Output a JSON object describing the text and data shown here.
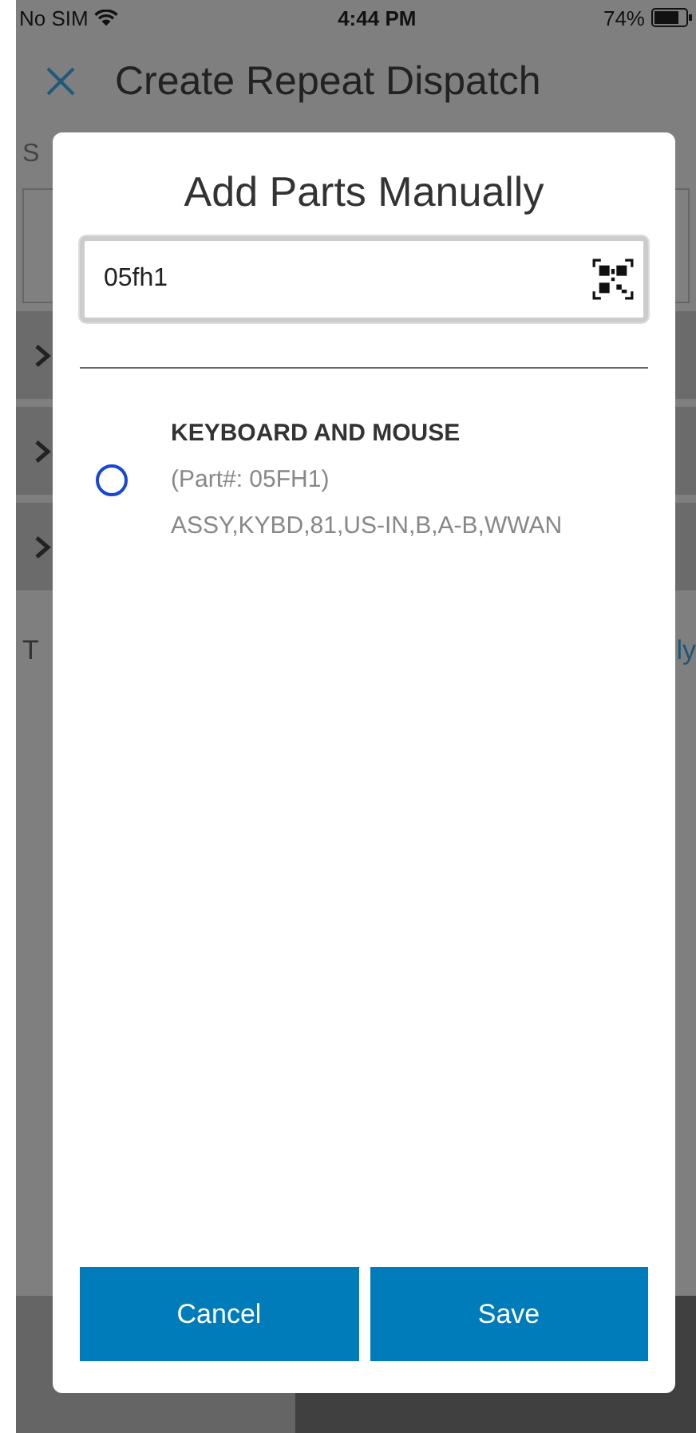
{
  "status_bar": {
    "carrier": "No SIM",
    "time": "4:44 PM",
    "battery": "74%"
  },
  "screen": {
    "title": "Create Repeat Dispatch",
    "label_fragment": "S",
    "text_fragment": "T",
    "link_fragment": "ly"
  },
  "dialog": {
    "title": "Add Parts Manually",
    "search": {
      "value": "05fh1"
    },
    "results": [
      {
        "name": "KEYBOARD AND MOUSE",
        "part_number": "(Part#:  05FH1)",
        "description": "ASSY,KYBD,81,US-IN,B,A-B,WWAN",
        "selected": false
      }
    ],
    "buttons": [
      {
        "label": "Cancel"
      },
      {
        "label": "Save"
      }
    ]
  }
}
